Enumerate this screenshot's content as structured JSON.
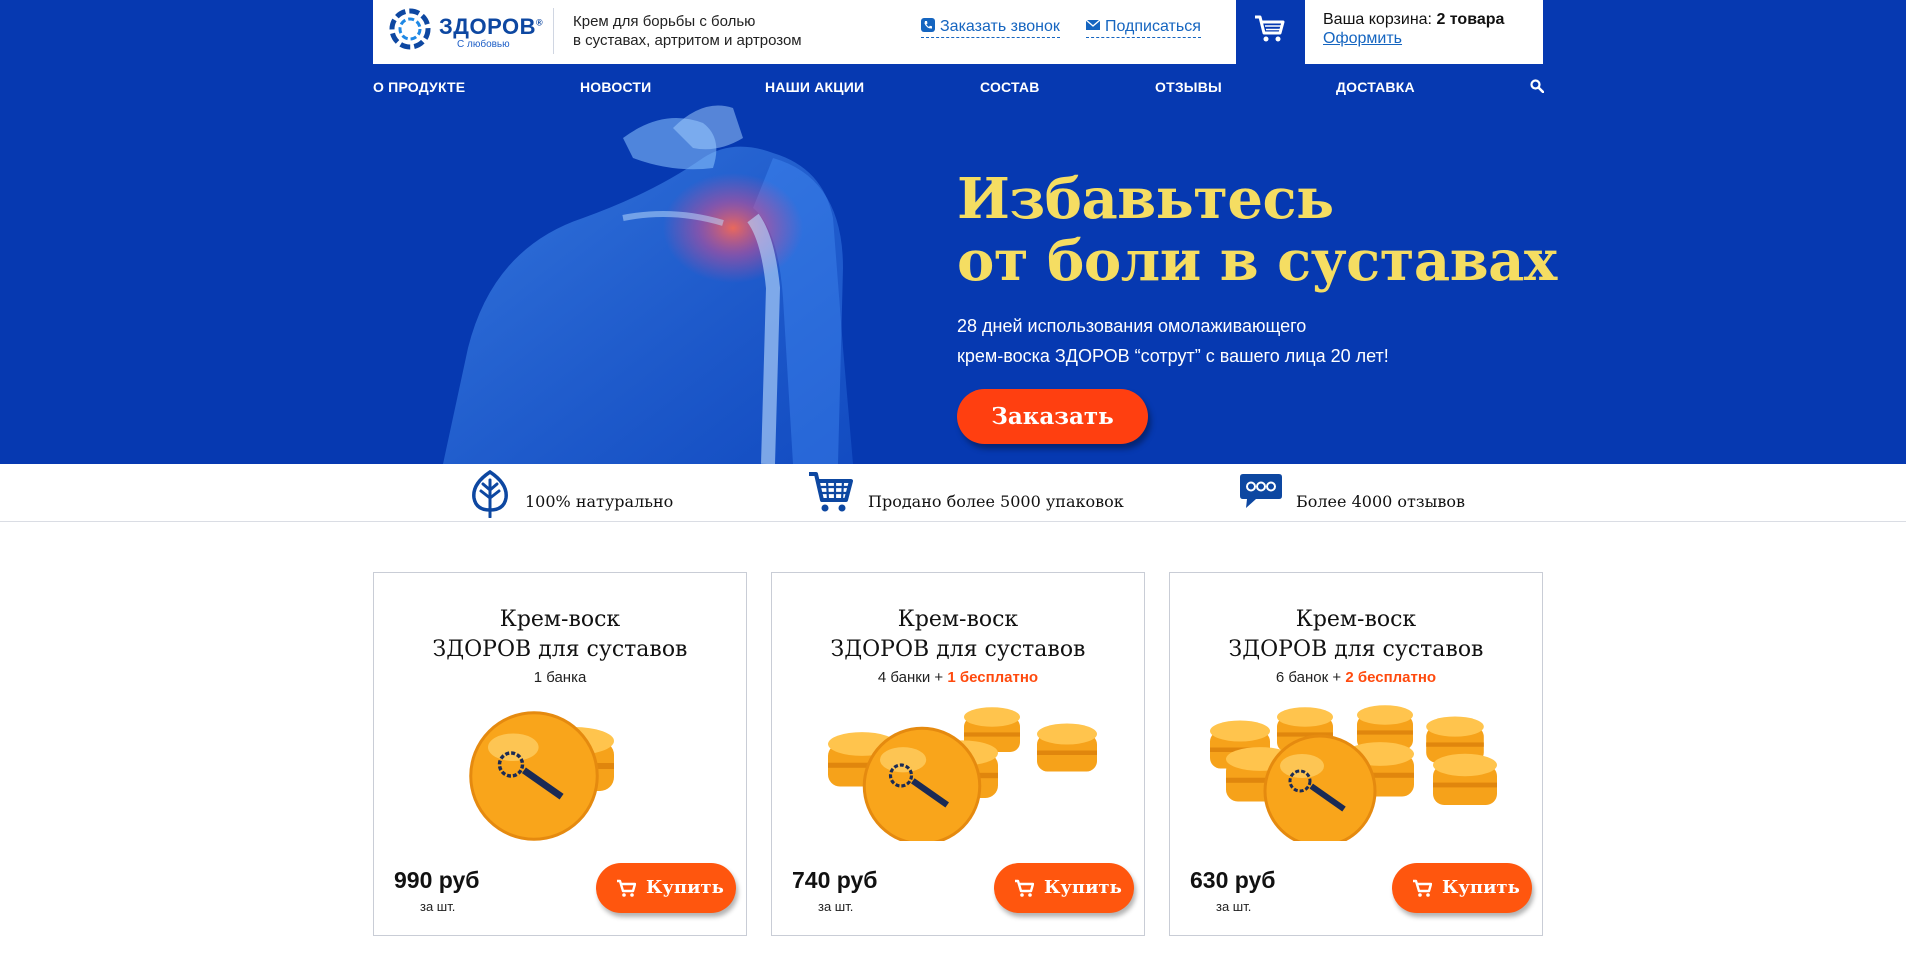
{
  "brand": {
    "name": "ЗДОРОВ",
    "mark": "®",
    "slogan": "С любовью"
  },
  "header": {
    "tagline_line1": "Крем для борьбы с болью",
    "tagline_line2": "в суставах, артритом и артрозом",
    "callback_label": "Заказать звонок",
    "subscribe_label": "Подписаться",
    "basket_label": "Ваша корзина:",
    "basket_count": "2 товара",
    "checkout_label": "Оформить"
  },
  "nav": {
    "items": [
      "О ПРОДУКТЕ",
      "НОВОСТИ",
      "НАШИ АКЦИИ",
      "СОСТАВ",
      "ОТЗЫВЫ",
      "ДОСТАВКА"
    ]
  },
  "hero": {
    "title_line1": "Избавьтесь",
    "title_line2": "от боли в суставах",
    "text_line1": "28 дней использования омолаживающего",
    "text_line2": "крем-воска ЗДОРОВ “сотрут” с вашего лица 20 лет!",
    "order_label": "Заказать"
  },
  "features": [
    {
      "icon": "leaf-icon",
      "text": "100% натурально"
    },
    {
      "icon": "cart-icon",
      "text": "Продано более 5000 упаковок"
    },
    {
      "icon": "chat-icon",
      "text": "Более 4000 отзывов"
    }
  ],
  "products": [
    {
      "title_line1": "Крем-воск",
      "title_line2": "ЗДОРОВ для суставов",
      "qty": "1 банка",
      "plus": "",
      "free": "",
      "price": "990 руб",
      "per": "за шт.",
      "buy_label": "Купить",
      "jars": 1
    },
    {
      "title_line1": "Крем-воск",
      "title_line2": "ЗДОРОВ для суставов",
      "qty": "4 банки",
      "plus": " + ",
      "free": "1 бесплатно",
      "price": "740 руб",
      "per": "за шт.",
      "buy_label": "Купить",
      "jars": 5
    },
    {
      "title_line1": "Крем-воск",
      "title_line2": "ЗДОРОВ для суставов",
      "qty": "6 банок",
      "plus": " + ",
      "free": "2 бесплатно",
      "price": "630 руб",
      "per": "за шт.",
      "buy_label": "Купить",
      "jars": 8
    }
  ],
  "colors": {
    "brand_blue": "#0639b1",
    "accent_orange": "#ff560e",
    "hero_title_yellow": "#f5dd62",
    "link_blue": "#1565c0"
  }
}
